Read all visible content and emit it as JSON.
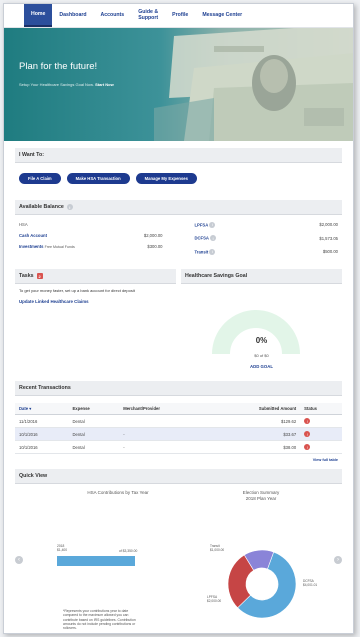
{
  "nav": {
    "items": [
      {
        "label": "Home",
        "active": true
      },
      {
        "label": "Dashboard"
      },
      {
        "label": "Accounts"
      },
      {
        "label": "Guide & Support"
      },
      {
        "label": "Profile"
      },
      {
        "label": "Message Center"
      }
    ]
  },
  "hero": {
    "title": "Plan for the future!",
    "subtitle": "Setup Your Healthcare Savings Goal Now.",
    "subtitle_link": "Start Now"
  },
  "i_want_to": {
    "heading": "I Want To:",
    "buttons": [
      "File A Claim",
      "Make HSA Transaction",
      "Manage My Expenses"
    ]
  },
  "available_balance": {
    "heading": "Available Balance",
    "left": {
      "group_label": "HSA",
      "rows": [
        {
          "label": "Cash Account",
          "value": "$2,000.00"
        },
        {
          "label": "Investments",
          "note": "Free Mutual Funds",
          "value": "$300.00"
        }
      ]
    },
    "right": {
      "rows": [
        {
          "label": "LPFSA",
          "value": "$2,000.00"
        },
        {
          "label": "DCFSA",
          "value": "$1,573.05"
        },
        {
          "label": "Transit",
          "value": "$500.00"
        }
      ]
    }
  },
  "tasks": {
    "heading": "Tasks",
    "count": "2",
    "text": "To get your money faster, set up a bank account for direct deposit",
    "link": "Update Linked Healthcare Claims"
  },
  "savings_goal": {
    "heading": "Healthcare Savings Goal",
    "percent": "0%",
    "progress": 0,
    "amount": "$0 of $0",
    "link": "ADD GOAL"
  },
  "recent_transactions": {
    "heading": "Recent Transactions",
    "columns": [
      "Date",
      "Expense",
      "Merchant/Provider",
      "Submitted Amount",
      "Status"
    ],
    "rows": [
      {
        "date": "11/1/2016",
        "expense": "Dental",
        "merchant": "",
        "amount": "$129.62",
        "status": "!"
      },
      {
        "date": "10/1/2016",
        "expense": "Dental",
        "merchant": "-",
        "amount": "$33.67",
        "status": "!"
      },
      {
        "date": "10/1/2016",
        "expense": "Dental",
        "merchant": "-",
        "amount": "$38.00",
        "status": "!"
      }
    ],
    "view_all": "View full table"
  },
  "quick_view": {
    "heading": "Quick View",
    "left_title": "HSA Contributions by Tax Year",
    "right_title_line1": "Election Summary",
    "right_title_line2": "2018 Plan Year",
    "footnote": "*Represents your contributions year to date compared to the maximum allowed you can contribute based on IRS guidelines. Contribution amounts do not include pending contributions or rollovers.",
    "colors": {
      "bar": "#5aa8da",
      "hsa": "#5aa8da",
      "lpfsa": "#c64545",
      "transit": "#8a84d8"
    }
  },
  "chart_data": [
    {
      "type": "bar",
      "title": "HSA Contributions by Tax Year",
      "categories": [
        "2018"
      ],
      "tick_label": "2018\n$1,400",
      "values": [
        1400
      ],
      "max_label": "of $3,350.00",
      "xlim": [
        0,
        3350
      ]
    },
    {
      "type": "pie",
      "title": "Election Summary 2018 Plan Year",
      "labels": [
        "DCFSA",
        "LPFSA",
        "Transit"
      ],
      "values": [
        4000,
        2000,
        1000
      ],
      "value_labels": [
        "$4,001.01",
        "$2,000.00",
        "$1,000.00"
      ],
      "colors": [
        "#5aa8da",
        "#c64545",
        "#8a84d8"
      ]
    }
  ],
  "carousel": {
    "pages": 3,
    "active": 1
  }
}
